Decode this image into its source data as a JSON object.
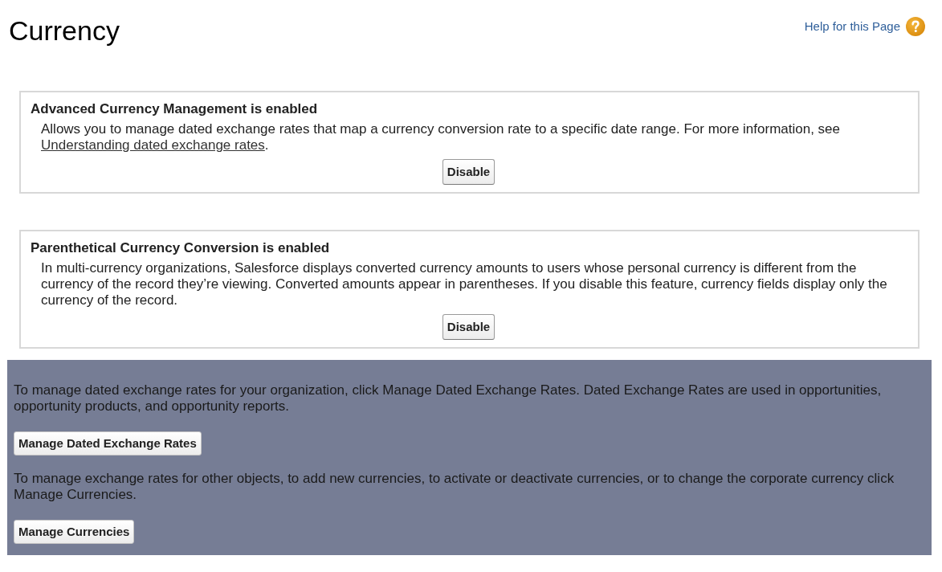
{
  "page": {
    "title": "Currency",
    "help_link": "Help for this Page"
  },
  "features": [
    {
      "title": "Advanced Currency Management is enabled",
      "description": "Allows you to manage dated exchange rates that map a currency conversion rate to a specific date range. For more information, see",
      "link": "Understanding dated exchange rates",
      "after_link": ".",
      "button": "Disable"
    },
    {
      "title": "Parenthetical Currency Conversion is enabled",
      "description": "In multi-currency organizations, Salesforce displays converted currency amounts to users whose personal currency is different from the currency of the record they’re viewing. Converted amounts appear in parentheses. If you disable this feature, currency fields display only the currency of the record.",
      "button": "Disable"
    }
  ],
  "manage_panel": [
    {
      "text": "To manage dated exchange rates for your organization, click Manage Dated Exchange Rates. Dated Exchange Rates are used in opportunities, opportunity products, and opportunity reports.",
      "button": "Manage Dated Exchange Rates"
    },
    {
      "text": "To manage exchange rates for other objects, to add new currencies, to activate or deactivate currencies, or to change the corporate currency click Manage Currencies.",
      "button": "Manage Currencies"
    }
  ]
}
